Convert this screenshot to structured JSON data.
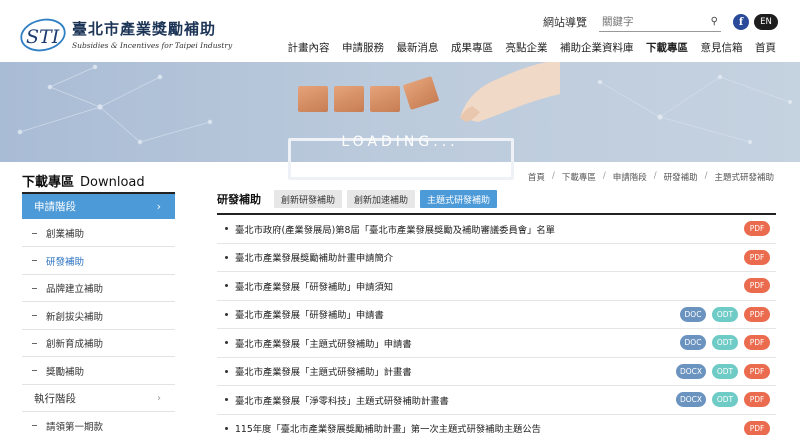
{
  "header": {
    "logo_mark": "STI",
    "logo_title": "臺北市產業獎勵補助",
    "logo_subtitle": "Subsidies & Incentives for Taipei Industry",
    "sitemap": "網站導覽",
    "search_placeholder": "關鍵字",
    "facebook": "f",
    "language": "EN",
    "nav": [
      "計畫內容",
      "申請服務",
      "最新消息",
      "成果專區",
      "亮點企業",
      "補助企業資料庫",
      "下載專區",
      "意見信箱",
      "首頁"
    ],
    "nav_active_index": 6
  },
  "banner": {
    "loading_text": "LOADING..."
  },
  "sidebar": {
    "title": "下載專區",
    "title_en": "Download",
    "active_group": "申請階段",
    "items": [
      "創業補助",
      "研發補助",
      "品牌建立補助",
      "新創拔尖補助",
      "創新育成補助",
      "獎勵補助"
    ],
    "current_item_index": 1,
    "group2": "執行階段",
    "items2": [
      "請領第一期款"
    ]
  },
  "breadcrumb": [
    "首頁",
    "下載專區",
    "申請階段",
    "研發補助",
    "主題式研發補助"
  ],
  "main": {
    "title": "研發補助",
    "tabs": [
      "創新研發補助",
      "創新加速補助",
      "主題式研發補助"
    ],
    "active_tab_index": 2,
    "rows": [
      {
        "text": "臺北市政府(產業發展局)第8屆「臺北市產業發展獎勵及補助審議委員會」名單",
        "files": [
          "PDF"
        ]
      },
      {
        "text": "臺北市產業發展獎勵補助計畫申請簡介",
        "files": [
          "PDF"
        ]
      },
      {
        "text": "臺北市產業發展「研發補助」申請須知",
        "files": [
          "PDF"
        ]
      },
      {
        "text": "臺北市產業發展「研發補助」申請書",
        "files": [
          "DOC",
          "ODT",
          "PDF"
        ]
      },
      {
        "text": "臺北市產業發展「主題式研發補助」申請書",
        "files": [
          "DOC",
          "ODT",
          "PDF"
        ]
      },
      {
        "text": "臺北市產業發展「主題式研發補助」計畫書",
        "files": [
          "DOCX",
          "ODT",
          "PDF"
        ]
      },
      {
        "text": "臺北市產業發展「淨零科技」主題式研發補助計畫書",
        "files": [
          "DOCX",
          "ODT",
          "PDF"
        ]
      },
      {
        "text": "115年度「臺北市產業發展獎勵補助計畫」第一次主題式研發補助主題公告",
        "files": [
          "PDF"
        ]
      }
    ]
  },
  "colors": {
    "accent": "#4d9ad8",
    "pdf": "#ea6b4e",
    "doc": "#6b93bf",
    "odt": "#6fcbc6"
  }
}
